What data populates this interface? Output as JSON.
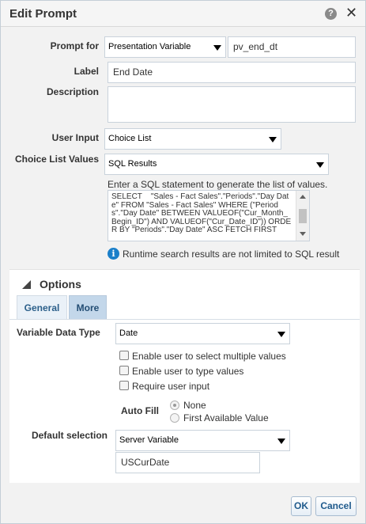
{
  "dialog": {
    "title": "Edit Prompt",
    "help_icon_glyph": "?",
    "close_icon_glyph": "✕"
  },
  "form": {
    "prompt_for_label": "Prompt for",
    "prompt_for_type": "Presentation Variable",
    "prompt_for_variable": "pv_end_dt",
    "label_label": "Label",
    "label_value": "End Date",
    "description_label": "Description",
    "description_value": "",
    "user_input_label": "User Input",
    "user_input_value": "Choice List",
    "choice_list_values_label": "Choice List Values",
    "choice_list_values_value": "SQL Results",
    "sql_instruction": "Enter a SQL statement to generate the list of values.",
    "sql_text": "SELECT    \"Sales - Fact Sales\".\"Periods\".\"Day Date\" FROM \"Sales - Fact Sales\" WHERE (\"Periods\".\"Day Date\" BETWEEN VALUEOF(\"Cur_Month_Begin_ID\") AND VALUEOF(\"Cur_Date_ID\")) ORDER BY \"Periods\".\"Day Date\" ASC FETCH FIRST",
    "info_glyph": "i",
    "runtime_note": "Runtime search results are not limited to SQL result"
  },
  "options": {
    "header": "Options",
    "tabs": [
      {
        "label": "General",
        "active": false
      },
      {
        "label": "More",
        "active": true
      }
    ],
    "variable_data_type_label": "Variable Data Type",
    "variable_data_type_value": "Date",
    "checkboxes": [
      {
        "label": "Enable user to select multiple values",
        "checked": false
      },
      {
        "label": "Enable user to type values",
        "checked": false
      },
      {
        "label": "Require user input",
        "checked": false
      }
    ],
    "auto_fill_label": "Auto Fill",
    "auto_fill_options": [
      {
        "label": "None",
        "selected": true
      },
      {
        "label": "First Available Value",
        "selected": false
      }
    ],
    "default_selection_label": "Default selection",
    "default_selection_value": "Server Variable",
    "default_selection_variable": "USCurDate"
  },
  "buttons": {
    "ok_label": "OK",
    "cancel_label": "Cancel"
  },
  "colors": {
    "accent": "#1f5a8c",
    "info": "#1a7fc9",
    "tab_active": "#c3d7ea",
    "tab_inactive": "#eaf1f8"
  }
}
